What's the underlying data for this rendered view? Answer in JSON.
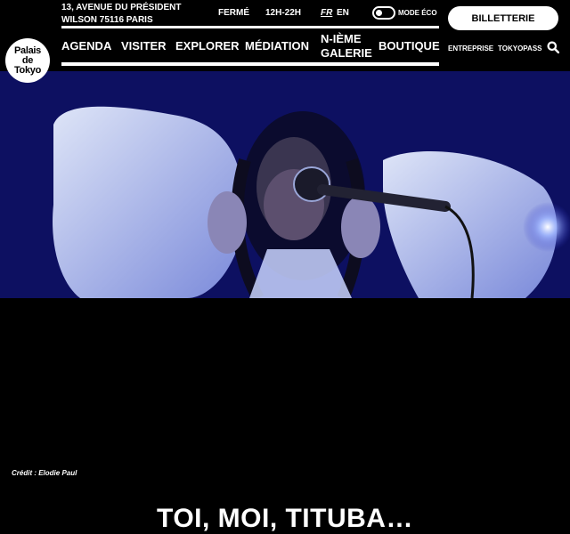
{
  "header": {
    "logo_lines": [
      "Palais",
      "de",
      "Tokyo"
    ],
    "address_line1": "13, AVENUE DU PRÉSIDENT",
    "address_line2": "WILSON 75116 PARIS",
    "status": "FERMÉ",
    "hours": "12H-22H",
    "lang_fr": "FR",
    "lang_en": "EN",
    "eco_mode_label": "MODE ÉCO",
    "ticket_label": "BILLETTERIE"
  },
  "nav": {
    "agenda": "AGENDA",
    "visiter": "VISITER",
    "explorer": "EXPLORER",
    "mediation": "MÉDIATION",
    "galerie_line1": "N-IÈME",
    "galerie_line2": "GALERIE",
    "boutique": "BOUTIQUE",
    "entreprise": "ENTREPRISE",
    "tokyopass": "TOKYOPASS"
  },
  "hero": {
    "credit": "Crédit : Elodie Paul"
  },
  "main": {
    "title": "TOI, MOI, TITUBA…"
  },
  "colors": {
    "background": "#000000",
    "hero_blue": "#0c0f6a",
    "text": "#ffffff"
  }
}
